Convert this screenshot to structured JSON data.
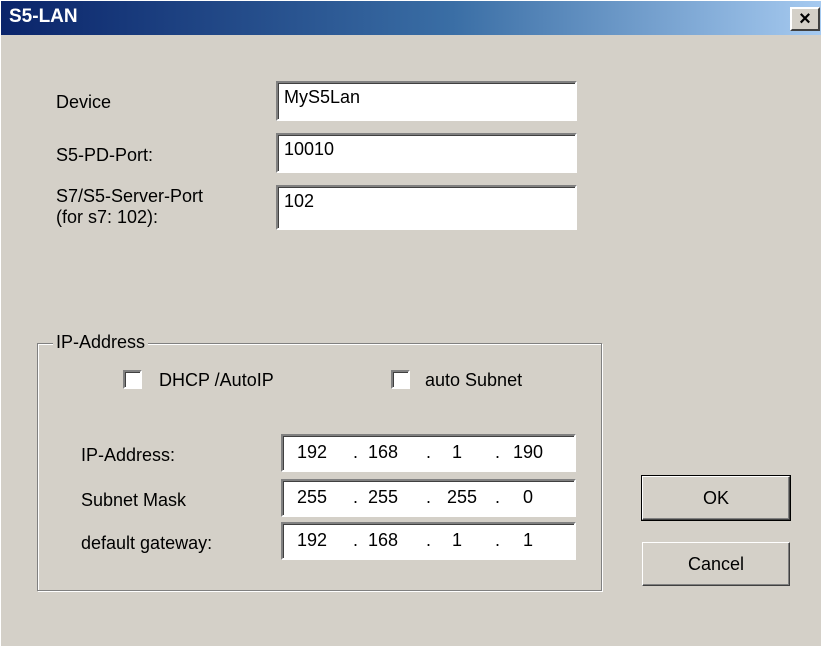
{
  "window": {
    "title": "S5-LAN",
    "close_symbol": "×"
  },
  "form": {
    "device_label": "Device",
    "device_value": "MyS5Lan",
    "pd_port_label": "S5-PD-Port:",
    "pd_port_value": "10010",
    "server_port_label_line1": "S7/S5-Server-Port",
    "server_port_label_line2": "(for s7: 102):",
    "server_port_value": "102"
  },
  "ip_group": {
    "legend": "IP-Address",
    "dhcp_label": "DHCP /AutoIP",
    "dhcp_checked": false,
    "auto_subnet_label": "auto Subnet",
    "auto_subnet_checked": false,
    "ip_label": "IP-Address:",
    "ip_octets": [
      "192",
      "168",
      "1",
      "190"
    ],
    "mask_label": "Subnet Mask",
    "mask_octets": [
      "255",
      "255",
      "255",
      "0"
    ],
    "gateway_label": "default gateway:",
    "gateway_octets": [
      "192",
      "168",
      "1",
      "1"
    ]
  },
  "buttons": {
    "ok": "OK",
    "cancel": "Cancel"
  }
}
